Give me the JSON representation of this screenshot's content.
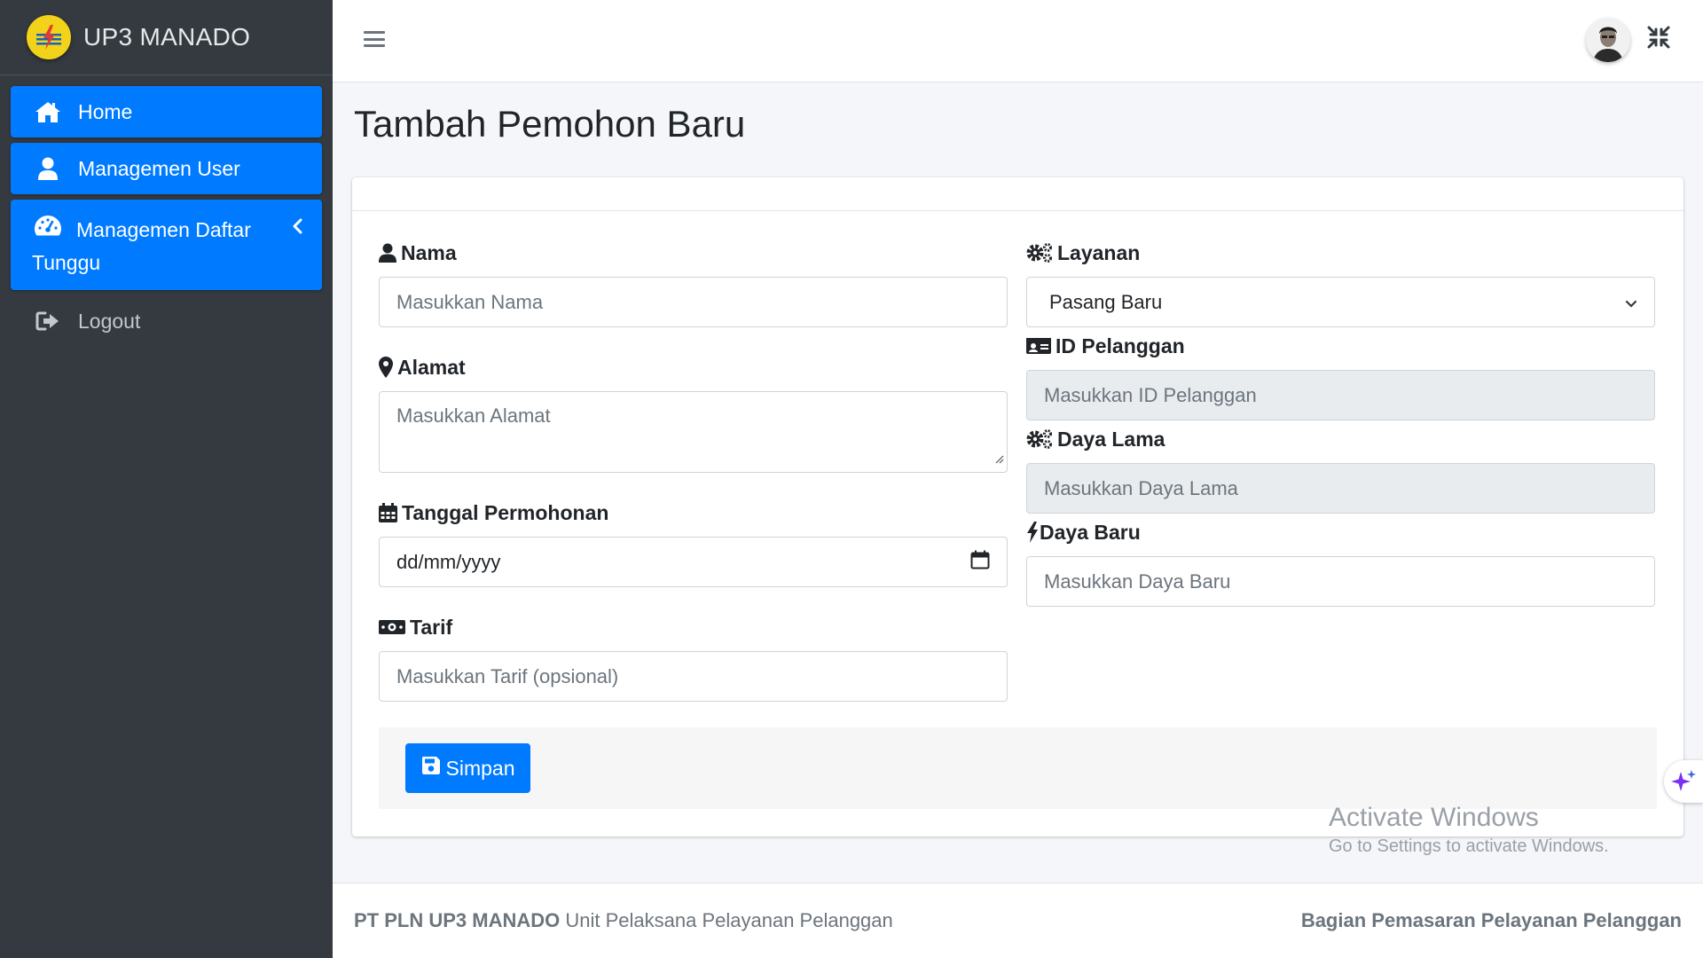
{
  "brand": {
    "name": "UP3 MANADO",
    "logo_icon": "pln-logo-icon"
  },
  "sidebar": {
    "items": [
      {
        "label": "Home",
        "icon": "home-icon",
        "active": true
      },
      {
        "label": "Managemen User",
        "icon": "user-icon",
        "active": true
      },
      {
        "label": "Managemen Daftar Tunggu",
        "icon": "tachometer-icon",
        "active": true,
        "expandable": true
      },
      {
        "label": "Logout",
        "icon": "sign-out-icon",
        "active": false
      }
    ]
  },
  "topbar": {
    "menu_icon": "hamburger-icon",
    "avatar_icon": "user-avatar",
    "fullscreen_icon": "compress-icon"
  },
  "page": {
    "title": "Tambah Pemohon Baru"
  },
  "form": {
    "nama": {
      "label": "Nama",
      "placeholder": "Masukkan Nama"
    },
    "alamat": {
      "label": "Alamat",
      "placeholder": "Masukkan Alamat"
    },
    "tanggal": {
      "label": "Tanggal Permohonan",
      "value": "dd/mm/yyyy"
    },
    "tarif": {
      "label": "Tarif",
      "placeholder": "Masukkan Tarif (opsional)"
    },
    "layanan": {
      "label": "Layanan",
      "value": "Pasang Baru"
    },
    "id_pelanggan": {
      "label": "ID Pelanggan",
      "placeholder": "Masukkan ID Pelanggan"
    },
    "daya_lama": {
      "label": "Daya Lama",
      "placeholder": "Masukkan Daya Lama"
    },
    "daya_baru": {
      "label": "Daya Baru",
      "placeholder": "Masukkan Daya Baru"
    },
    "save_label": "Simpan"
  },
  "watermark": {
    "line1": "Activate Windows",
    "line2": "Go to Settings to activate Windows."
  },
  "footer": {
    "left_bold": "PT PLN UP3 MANADO",
    "left_text": "Unit Pelaksana Pelayanan Pelanggan",
    "right_text": "Bagian Pemasaran Pelayanan Pelanggan"
  },
  "colors": {
    "primary": "#007bff",
    "sidebar": "#343a40",
    "background": "#f4f6f9"
  }
}
